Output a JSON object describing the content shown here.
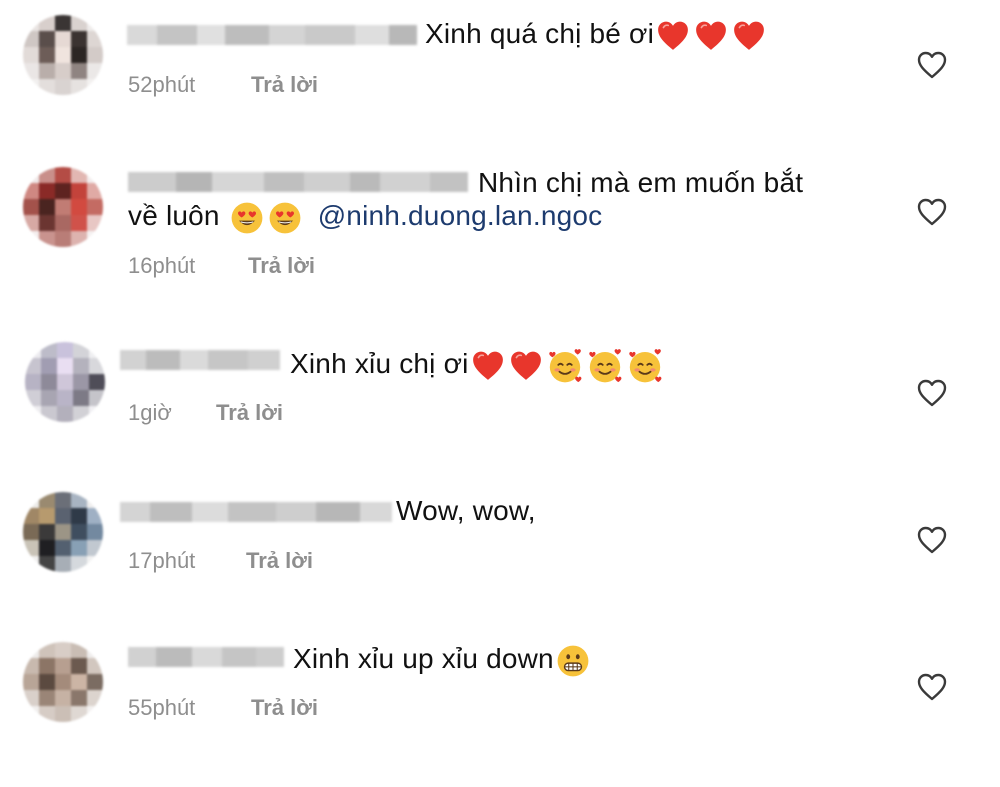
{
  "comments": [
    {
      "text": "Xinh quá chị bé ơi",
      "emojis": [
        "red-heart",
        "red-heart",
        "red-heart"
      ],
      "time": "52phút",
      "reply": "Trả lời",
      "liked": false
    },
    {
      "text_line1": "Nhìn chị mà em muốn bắt",
      "text_line2": "về luôn",
      "emojis": [
        "heart-eyes",
        "heart-eyes"
      ],
      "mention": "@ninh.duong.lan.ngoc",
      "time": "16phút",
      "reply": "Trả lời",
      "liked": false
    },
    {
      "text": "Xinh xỉu chị ơi",
      "emojis": [
        "red-heart",
        "red-heart",
        "smiling-hearts",
        "smiling-hearts",
        "smiling-hearts"
      ],
      "time": "1giờ",
      "reply": "Trả lời",
      "liked": false
    },
    {
      "text": "Wow, wow,",
      "emojis": [],
      "time": "17phút",
      "reply": "Trả lời",
      "liked": false
    },
    {
      "text": "Xinh xỉu up xỉu down",
      "emojis": [
        "grimacing"
      ],
      "time": "55phút",
      "reply": "Trả lời",
      "liked": false
    }
  ],
  "colors": {
    "text": "#111111",
    "meta": "#8e8e8e",
    "mention": "#1d3b6e",
    "heart": "#e8362c",
    "emoji_face": "#f7c23a"
  }
}
